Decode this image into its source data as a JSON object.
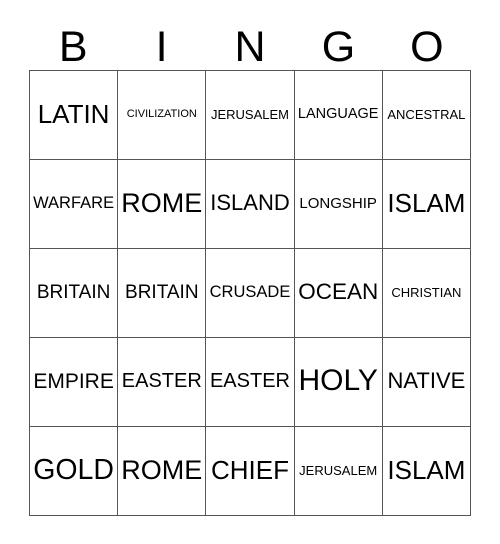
{
  "card": {
    "title": "BINGO",
    "columns": [
      "B",
      "I",
      "N",
      "G",
      "O"
    ],
    "rows": [
      {
        "cells": [
          {
            "text": "LATIN"
          },
          {
            "text": "CIVILIZATION"
          },
          {
            "text": "JERUSALEM"
          },
          {
            "text": "LANGUAGE"
          },
          {
            "text": "ANCESTRAL"
          }
        ]
      },
      {
        "cells": [
          {
            "text": "WARFARE"
          },
          {
            "text": "ROME"
          },
          {
            "text": "ISLAND"
          },
          {
            "text": "LONGSHIP"
          },
          {
            "text": "ISLAM"
          }
        ]
      },
      {
        "cells": [
          {
            "text": "BRITAIN"
          },
          {
            "text": "BRITAIN"
          },
          {
            "text": "CRUSADE"
          },
          {
            "text": "OCEAN"
          },
          {
            "text": "CHRISTIAN"
          }
        ]
      },
      {
        "cells": [
          {
            "text": "EMPIRE"
          },
          {
            "text": "EASTER"
          },
          {
            "text": "EASTER"
          },
          {
            "text": "HOLY"
          },
          {
            "text": "NATIVE"
          }
        ]
      },
      {
        "cells": [
          {
            "text": "GOLD"
          },
          {
            "text": "ROME"
          },
          {
            "text": "CHIEF"
          },
          {
            "text": "JERUSALEM"
          },
          {
            "text": "ISLAM"
          }
        ]
      }
    ],
    "colors": {
      "background": "#ffffff",
      "text": "#000000",
      "grid_line": "#555555"
    }
  }
}
